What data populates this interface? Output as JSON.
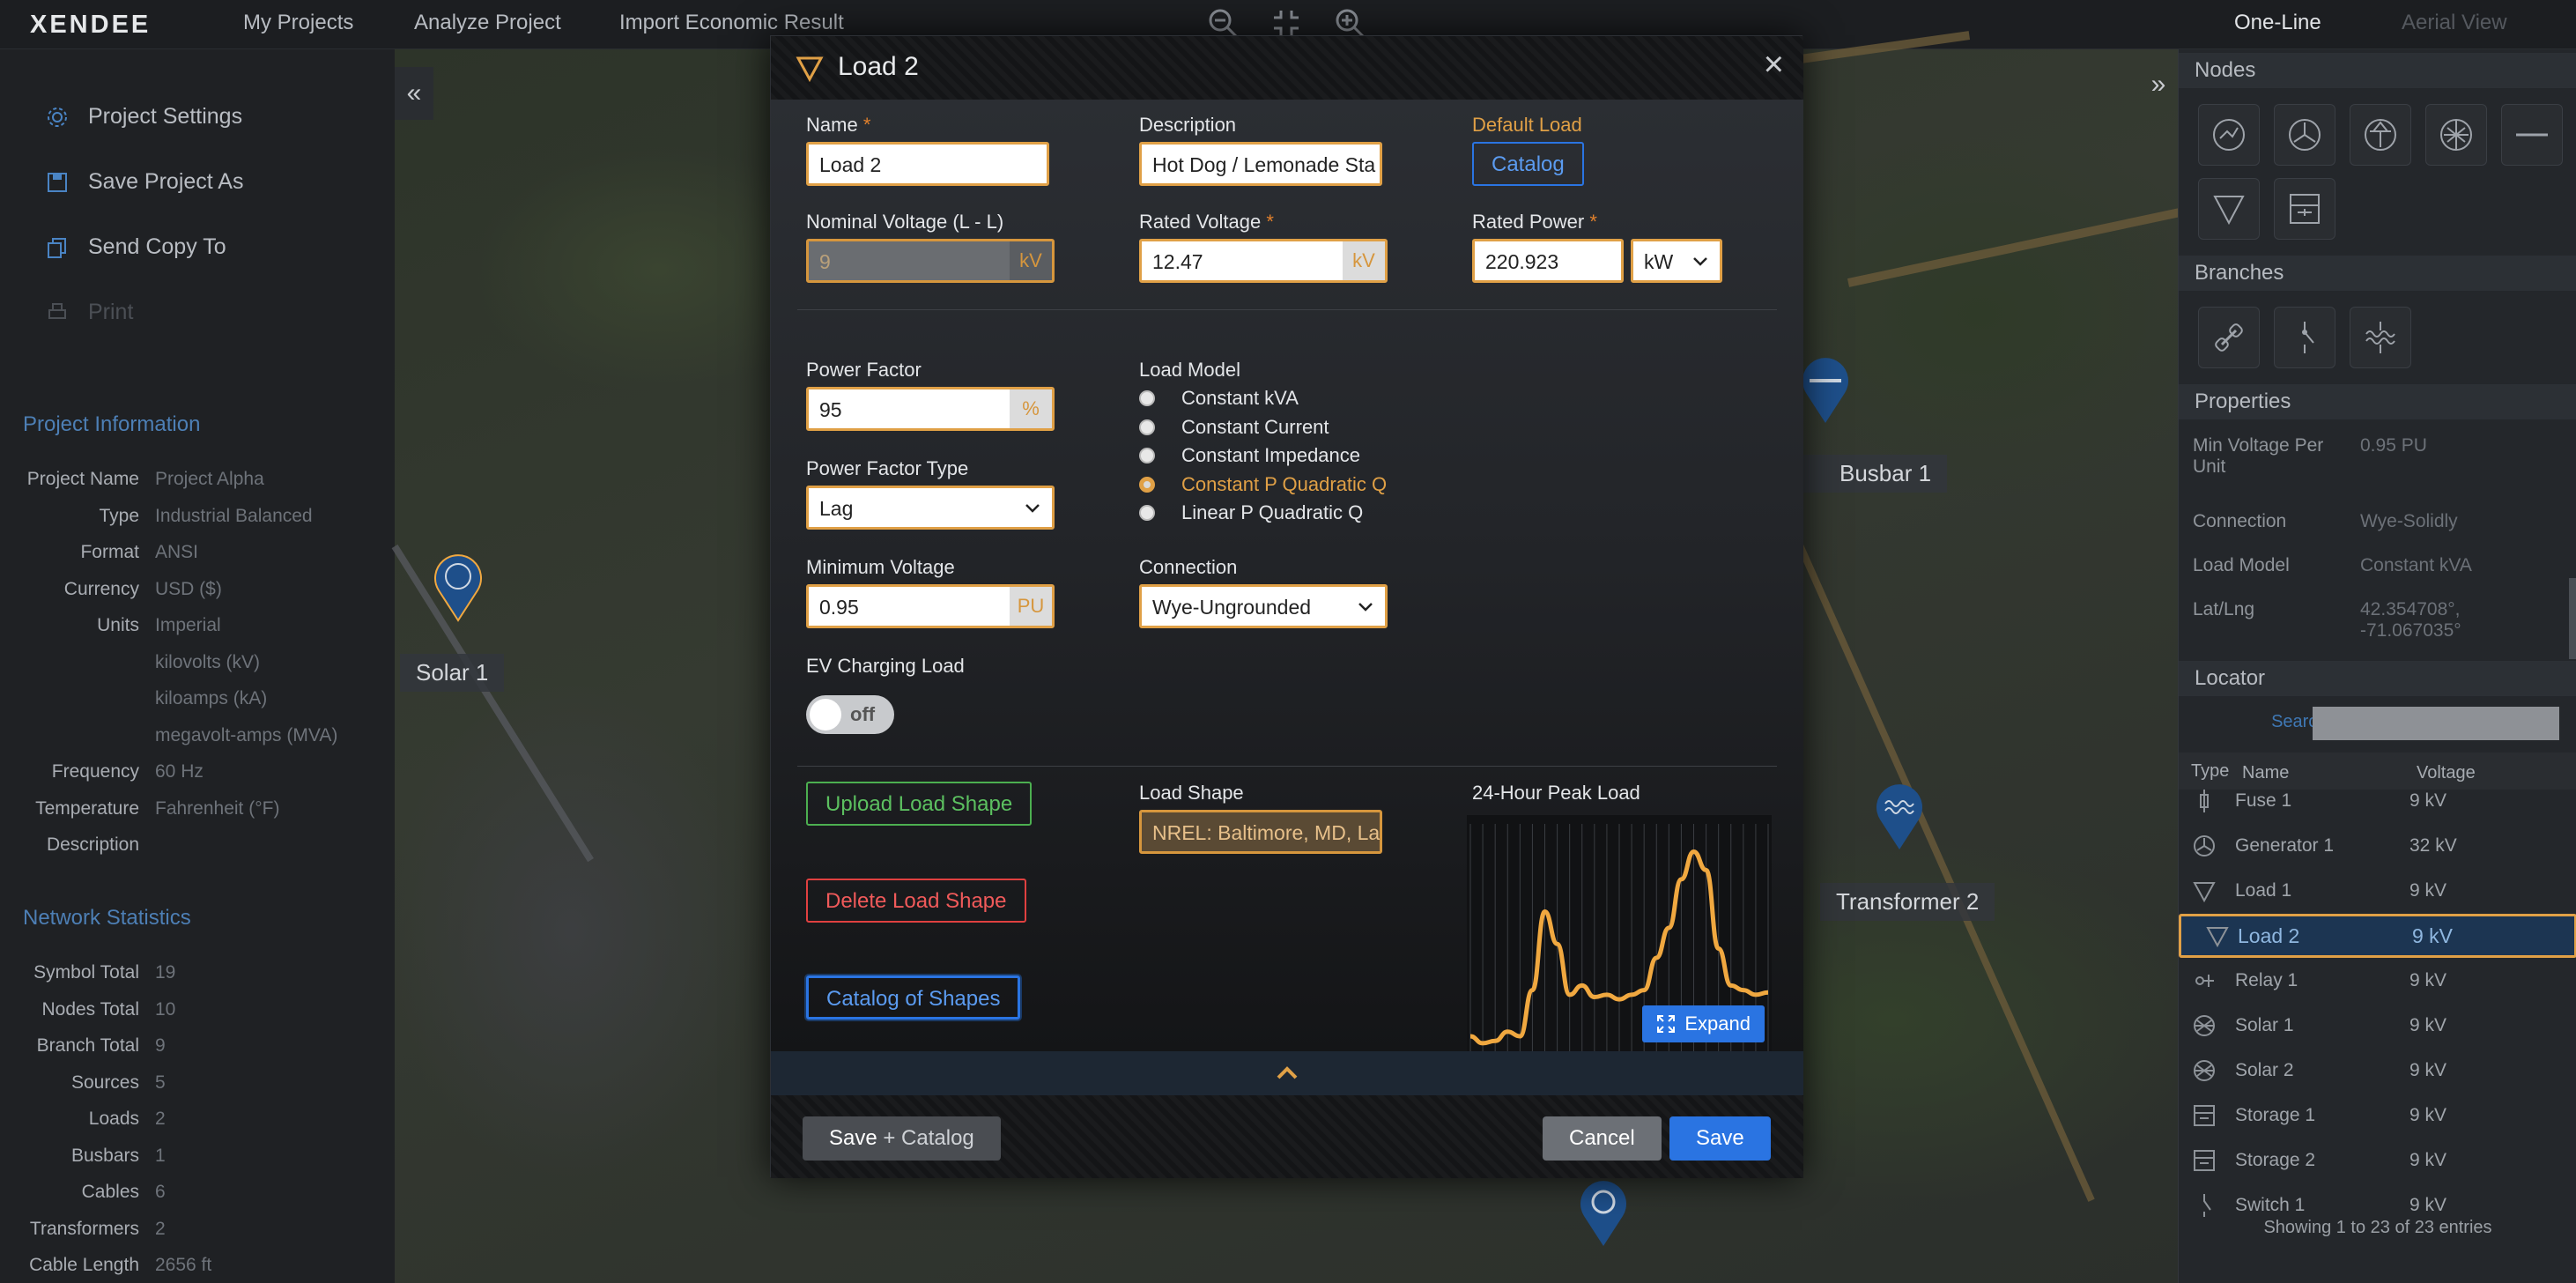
{
  "topbar": {
    "logo": "XENDEE",
    "nav": [
      "My Projects",
      "Analyze Project",
      "Import Economic Result"
    ],
    "view_tabs": [
      "One-Line",
      "Aerial View"
    ]
  },
  "sidebar": {
    "menu": [
      {
        "label": "Project Settings",
        "icon": "gear-icon"
      },
      {
        "label": "Save Project As",
        "icon": "save-icon"
      },
      {
        "label": "Send Copy To",
        "icon": "copy-icon"
      },
      {
        "label": "Print",
        "icon": "print-icon"
      }
    ],
    "project_info_title": "Project Information",
    "project_info": [
      {
        "k": "Project Name",
        "v": "Project Alpha"
      },
      {
        "k": "Type",
        "v": "Industrial Balanced"
      },
      {
        "k": "Format",
        "v": "ANSI"
      },
      {
        "k": "Currency",
        "v": "USD ($)"
      },
      {
        "k": "Units",
        "v": "Imperial"
      },
      {
        "k": "",
        "v": "kilovolts (kV)"
      },
      {
        "k": "",
        "v": "kiloamps (kA)"
      },
      {
        "k": "",
        "v": "megavolt-amps (MVA)"
      },
      {
        "k": "Frequency",
        "v": "60 Hz"
      },
      {
        "k": "Temperature",
        "v": "Fahrenheit (°F)"
      },
      {
        "k": "Description",
        "v": ""
      }
    ],
    "network_stats_title": "Network Statistics",
    "network_stats": [
      {
        "k": "Symbol Total",
        "v": "19"
      },
      {
        "k": "Nodes Total",
        "v": "10"
      },
      {
        "k": "Branch Total",
        "v": "9"
      },
      {
        "k": "Sources",
        "v": "5"
      },
      {
        "k": "Loads",
        "v": "2"
      },
      {
        "k": "Busbars",
        "v": "1"
      },
      {
        "k": "Cables",
        "v": "6"
      },
      {
        "k": "Transformers",
        "v": "2"
      },
      {
        "k": "Cable Length",
        "v": "2656 ft"
      }
    ]
  },
  "map": {
    "labels": [
      "Solar 1",
      "Busbar 1",
      "Transformer 2"
    ]
  },
  "rightpanel": {
    "nodes_title": "Nodes",
    "branches_title": "Branches",
    "properties_title": "Properties",
    "properties": [
      {
        "k": "Min Voltage Per Unit",
        "v": "0.95 PU"
      },
      {
        "k": "Connection",
        "v": "Wye-Solidly"
      },
      {
        "k": "Load Model",
        "v": "Constant kVA"
      },
      {
        "k": "Lat/Lng",
        "v": "42.354708°, -71.067035°"
      }
    ],
    "locator_title": "Locator",
    "search_label": "Search:",
    "columns": [
      "Type",
      "Name",
      "Voltage"
    ],
    "rows": [
      {
        "icon": "fuse-icon",
        "name": "Fuse 1",
        "v": "9 kV"
      },
      {
        "icon": "generator-icon",
        "name": "Generator 1",
        "v": "32 kV"
      },
      {
        "icon": "load-icon",
        "name": "Load 1",
        "v": "9 kV"
      },
      {
        "icon": "load-icon",
        "name": "Load 2",
        "v": "9 kV"
      },
      {
        "icon": "relay-icon",
        "name": "Relay 1",
        "v": "9 kV"
      },
      {
        "icon": "solar-icon",
        "name": "Solar 1",
        "v": "9 kV"
      },
      {
        "icon": "solar-icon",
        "name": "Solar 2",
        "v": "9 kV"
      },
      {
        "icon": "storage-icon",
        "name": "Storage 1",
        "v": "9 kV"
      },
      {
        "icon": "storage-icon",
        "name": "Storage 2",
        "v": "9 kV"
      },
      {
        "icon": "switch-icon",
        "name": "Switch 1",
        "v": "9 kV"
      }
    ],
    "footer": "Showing 1 to 23 of 23 entries"
  },
  "modal": {
    "title": "Load 2",
    "name_label": "Name",
    "name_value": "Load 2",
    "description_label": "Description",
    "description_value": "Hot Dog / Lemonade Sta",
    "default_load_label": "Default Load",
    "catalog_button": "Catalog",
    "nominal_voltage_label": "Nominal Voltage (L - L)",
    "nominal_voltage_value": "9",
    "kv_unit": "kV",
    "rated_voltage_label": "Rated Voltage",
    "rated_voltage_value": "12.47",
    "rated_power_label": "Rated Power",
    "rated_power_value": "220.923",
    "rated_power_unit": "kW",
    "power_factor_label": "Power Factor",
    "power_factor_value": "95",
    "percent_unit": "%",
    "load_model_label": "Load Model",
    "load_models": [
      "Constant kVA",
      "Constant Current",
      "Constant Impedance",
      "Constant P Quadratic Q",
      "Linear P Quadratic Q"
    ],
    "load_model_selected": 3,
    "power_factor_type_label": "Power Factor Type",
    "power_factor_type_value": "Lag",
    "minimum_voltage_label": "Minimum Voltage",
    "minimum_voltage_value": "0.95",
    "pu_unit": "PU",
    "connection_label": "Connection",
    "connection_value": "Wye-Ungrounded",
    "ev_label": "EV Charging Load",
    "ev_state": "off",
    "upload_button": "Upload Load Shape",
    "delete_button": "Delete Load Shape",
    "catalog_shapes_button": "Catalog of Shapes",
    "load_shape_label": "Load Shape",
    "load_shape_value": "NREL: Baltimore, MD, La",
    "peak_label": "24-Hour Peak Load",
    "expand_button": "Expand",
    "save_catalog_button": "Save",
    "save_catalog_suffix": "+ Catalog",
    "cancel_button": "Cancel",
    "save_button": "Save"
  },
  "colors": {
    "accent": "#e0a046",
    "primary": "#2a74e2",
    "success": "#4caf50",
    "danger": "#e04040"
  },
  "chart_data": {
    "type": "line",
    "title": "24-Hour Peak Load",
    "x": [
      0,
      1,
      2,
      3,
      4,
      5,
      6,
      7,
      8,
      9,
      10,
      11,
      12,
      13,
      14,
      15,
      16,
      17,
      18,
      19,
      20,
      21,
      22,
      23,
      24
    ],
    "values": [
      0.08,
      0.05,
      0.06,
      0.1,
      0.08,
      0.28,
      0.62,
      0.48,
      0.26,
      0.3,
      0.25,
      0.26,
      0.24,
      0.26,
      0.28,
      0.42,
      0.55,
      0.76,
      0.88,
      0.8,
      0.46,
      0.3,
      0.28,
      0.26,
      0.27
    ],
    "series_color": "#f0a840",
    "grid": true
  }
}
